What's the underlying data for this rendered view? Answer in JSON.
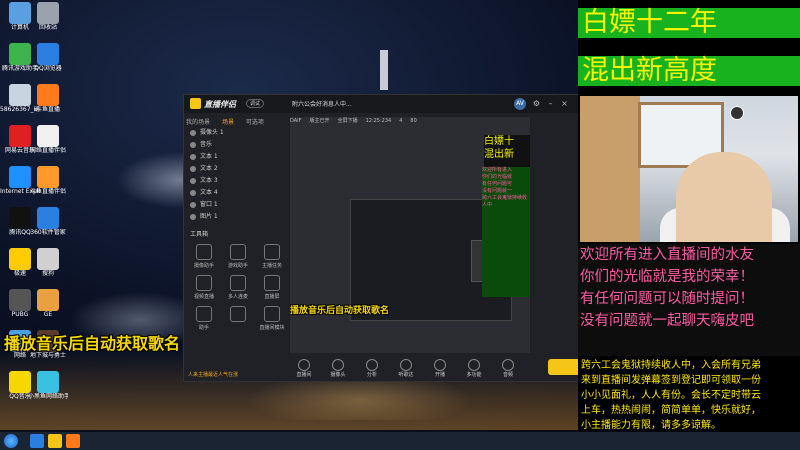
{
  "desktop": {
    "icons": [
      {
        "label": "计算机",
        "color": "#5aa0e0"
      },
      {
        "label": "回收站",
        "color": "#9aa3ad"
      },
      {
        "label": "腾讯游戏助手",
        "color": "#3cb44b"
      },
      {
        "label": "QQ浏览器",
        "color": "#2a7fe0"
      },
      {
        "label": "58626367_副本",
        "color": "#c8d4e0"
      },
      {
        "label": "斗鱼直播",
        "color": "#ff7a1a"
      },
      {
        "label": "网易云音乐",
        "color": "#e02020"
      },
      {
        "label": "网络直播伴侣",
        "color": "#f0f0f0"
      },
      {
        "label": "Internet Explorer",
        "color": "#1e90ff"
      },
      {
        "label": "斗鱼直播伴侣",
        "color": "#ff9a2a"
      },
      {
        "label": "腾讯QQ",
        "color": "#111111"
      },
      {
        "label": "360软件管家",
        "color": "#2a7fe0"
      },
      {
        "label": "极速",
        "color": "#ffcc00"
      },
      {
        "label": "搜狗",
        "color": "#d0d0d0"
      },
      {
        "label": "PUBG",
        "color": "#555555"
      },
      {
        "label": "GE",
        "color": "#e8a040"
      },
      {
        "label": "网络",
        "color": "#4aa0e0"
      },
      {
        "label": "地下城与勇士",
        "color": "#5a3a2a"
      },
      {
        "label": "QQ音乐",
        "color": "#f5d800"
      },
      {
        "label": "小黑鱼网络助手",
        "color": "#3ac0e0"
      }
    ]
  },
  "app": {
    "title": "直播伴侣",
    "badge": "调试",
    "address": "附六公会好消息人中...",
    "avatar_text": "AV",
    "scene_tabs": [
      "我的场景",
      "场景",
      "可选项"
    ],
    "sources": [
      "摄像头 1",
      "音乐",
      "文本 1",
      "文本 2",
      "文本 3",
      "文本 4",
      "窗口 1",
      "图片 1"
    ],
    "toolbox_title": "工具箱",
    "tools": [
      "摄像助手",
      "游戏助手",
      "主播任务",
      "视频直播",
      "多人连麦",
      "直播屏",
      "助手",
      "",
      "直播间模块"
    ],
    "preview_meta": [
      "DAIF",
      "版主已开",
      "全屏下播",
      "12:25:234",
      "4",
      "80"
    ],
    "bottom_actions": [
      "直播间",
      "摄像头",
      "分析",
      "听歌达",
      "开播",
      "多功能",
      "音频"
    ],
    "bottom_hint": "人来主播最近人气在涨",
    "mini_headline": [
      "白嫖十",
      "混出新"
    ],
    "mini_welcome": [
      "欢迎所有进入",
      "你们的光临就",
      "有任何问题可",
      "没有问题就一"
    ],
    "mini_notice": "跨六工会鬼狱持续收人中",
    "overlay_small": "播放音乐后自动获取歌名"
  },
  "overlay_large": "播放音乐后自动获取歌名",
  "right_panel": {
    "headline": [
      "白嫖十二年",
      "混出新高度"
    ],
    "welcome": [
      "欢迎所有进入直播间的水友",
      "你们的光临就是我的荣幸！",
      "有任何问题可以随时提问！",
      "没有问题就一起聊天嗨皮吧"
    ],
    "notice": [
      "跨六工会鬼狱持续收人中，入会所有兄弟",
      "来到直播间发弹幕签到登记即可领取一份",
      "小小见面礼，人人有份。会长不定时带云",
      "上车，热热闹闹，简简单单，快乐就好，",
      "小主播能力有限，请多多谅解。"
    ]
  },
  "colors": {
    "headline_bg": "#17b21d",
    "headline_text": "#f5f500",
    "welcome_text": "#ff5aa5",
    "notice_text": "#ffea00",
    "accent": "#f5c518"
  }
}
